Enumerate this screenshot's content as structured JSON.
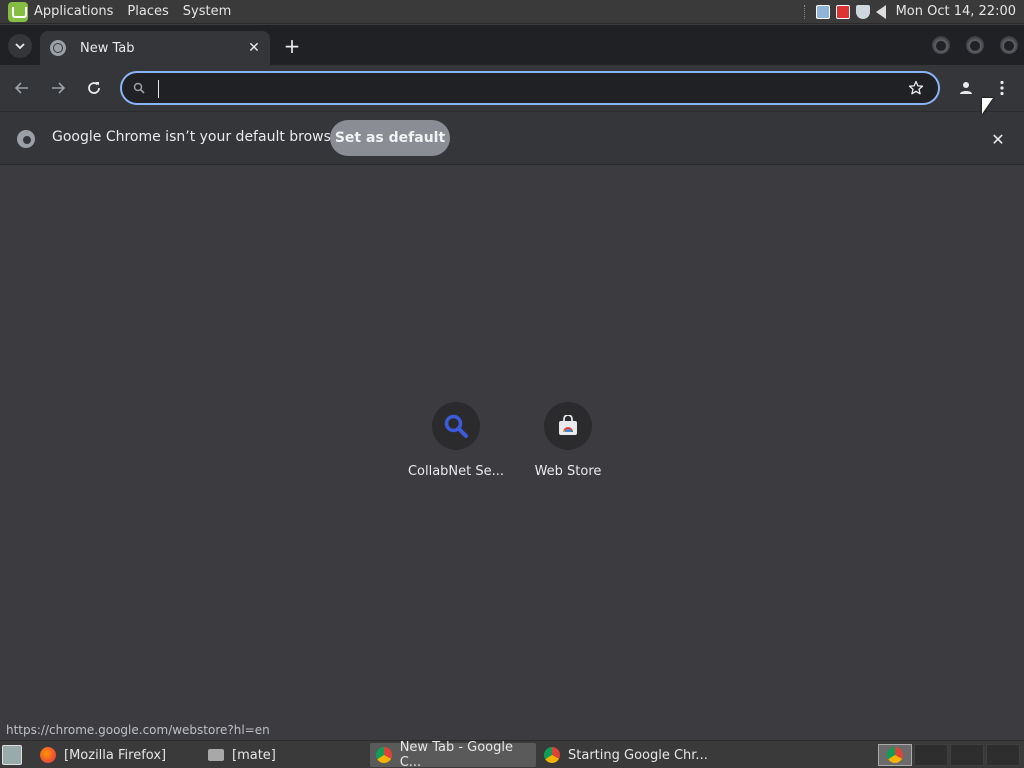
{
  "top_panel": {
    "menus": [
      "Applications",
      "Places",
      "System"
    ],
    "clock": "Mon Oct 14, 22:00"
  },
  "browser": {
    "tab": {
      "title": "New Tab",
      "close": "✕"
    },
    "new_tab": "+",
    "omnibox": {
      "value": "",
      "placeholder": ""
    },
    "infobar": {
      "message": "Google Chrome isn’t your default browser",
      "button": "Set as default",
      "close": "✕"
    },
    "shortcuts": [
      {
        "label": "CollabNet Se...",
        "icon": "search-icon"
      },
      {
        "label": "Web Store",
        "icon": "web-store-icon"
      }
    ],
    "status_url": "https://chrome.google.com/webstore?hl=en"
  },
  "taskbar": {
    "items": [
      {
        "label": "[Mozilla Firefox]",
        "icon": "firefox-icon"
      },
      {
        "label": "[mate]",
        "icon": "folder-icon"
      },
      {
        "label": "New Tab - Google C...",
        "icon": "chrome-icon",
        "active": true
      },
      {
        "label": "Starting Google Chr...",
        "icon": "chrome-icon"
      }
    ]
  },
  "colors": {
    "accent": "#8ab4f8",
    "page_bg": "#3c3b40",
    "toolbar_bg": "#35363a",
    "tabstrip_bg": "#202124"
  }
}
